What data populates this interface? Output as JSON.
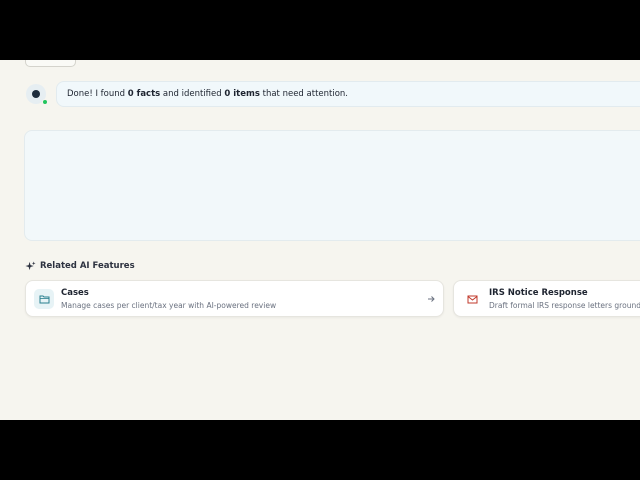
{
  "chat": {
    "message_prefix": "Done! I found ",
    "facts_count": "0 facts",
    "message_middle": " and identified ",
    "items_count": "0 items",
    "message_suffix": " that need attention."
  },
  "related": {
    "heading": "Related AI Features",
    "cards": [
      {
        "title": "Cases",
        "description": "Manage cases per client/tax year with AI-powered review",
        "icon": "folder-icon"
      },
      {
        "title": "IRS Notice Response",
        "description": "Draft formal IRS response letters grounded",
        "icon": "mail-icon"
      }
    ]
  },
  "colors": {
    "background": "#f6f5ef",
    "accent_teal": "#2a7f8f",
    "status_online": "#22c55e",
    "mail_red": "#c0392b"
  }
}
